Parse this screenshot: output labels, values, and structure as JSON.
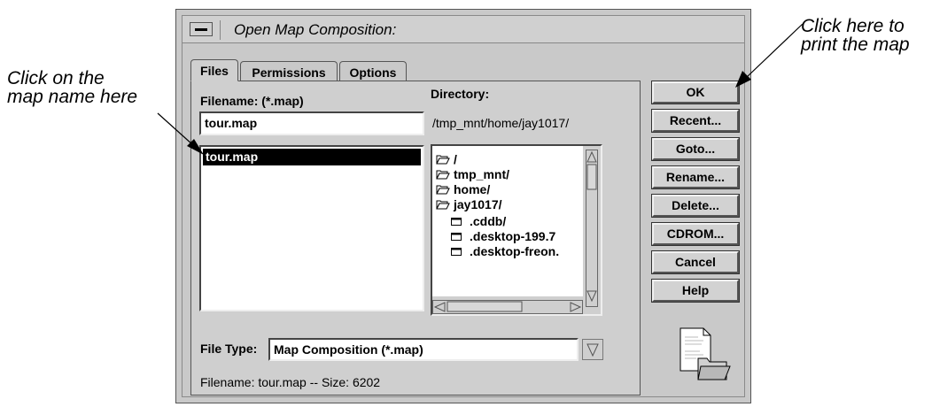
{
  "annotations": {
    "left": "Click on the\nmap name here",
    "right": "Click here to\nprint the map"
  },
  "dialog": {
    "title": "Open Map Composition:",
    "tabs": [
      "Files",
      "Permissions",
      "Options"
    ],
    "filename_label": "Filename: (*.map)",
    "filename_value": "tour.map",
    "file_list": [
      "tour.map"
    ],
    "directory_label": "Directory:",
    "directory_path": "/tmp_mnt/home/jay1017/",
    "directory_items": [
      {
        "name": "/",
        "type": "folder-open"
      },
      {
        "name": "tmp_mnt/",
        "type": "folder-open"
      },
      {
        "name": "home/",
        "type": "folder-open"
      },
      {
        "name": "jay1017/",
        "type": "folder-open"
      },
      {
        "name": ".cddb/",
        "type": "folder"
      },
      {
        "name": ".desktop-199.7",
        "type": "folder"
      },
      {
        "name": ".desktop-freon.",
        "type": "folder"
      }
    ],
    "file_type_label": "File Type:",
    "file_type_value": "Map Composition (*.map)",
    "status_text": "Filename: tour.map -- Size: 6202",
    "buttons": [
      "OK",
      "Recent...",
      "Goto...",
      "Rename...",
      "Delete...",
      "CDROM...",
      "Cancel",
      "Help"
    ],
    "file_icon": "document-folder-icon"
  }
}
